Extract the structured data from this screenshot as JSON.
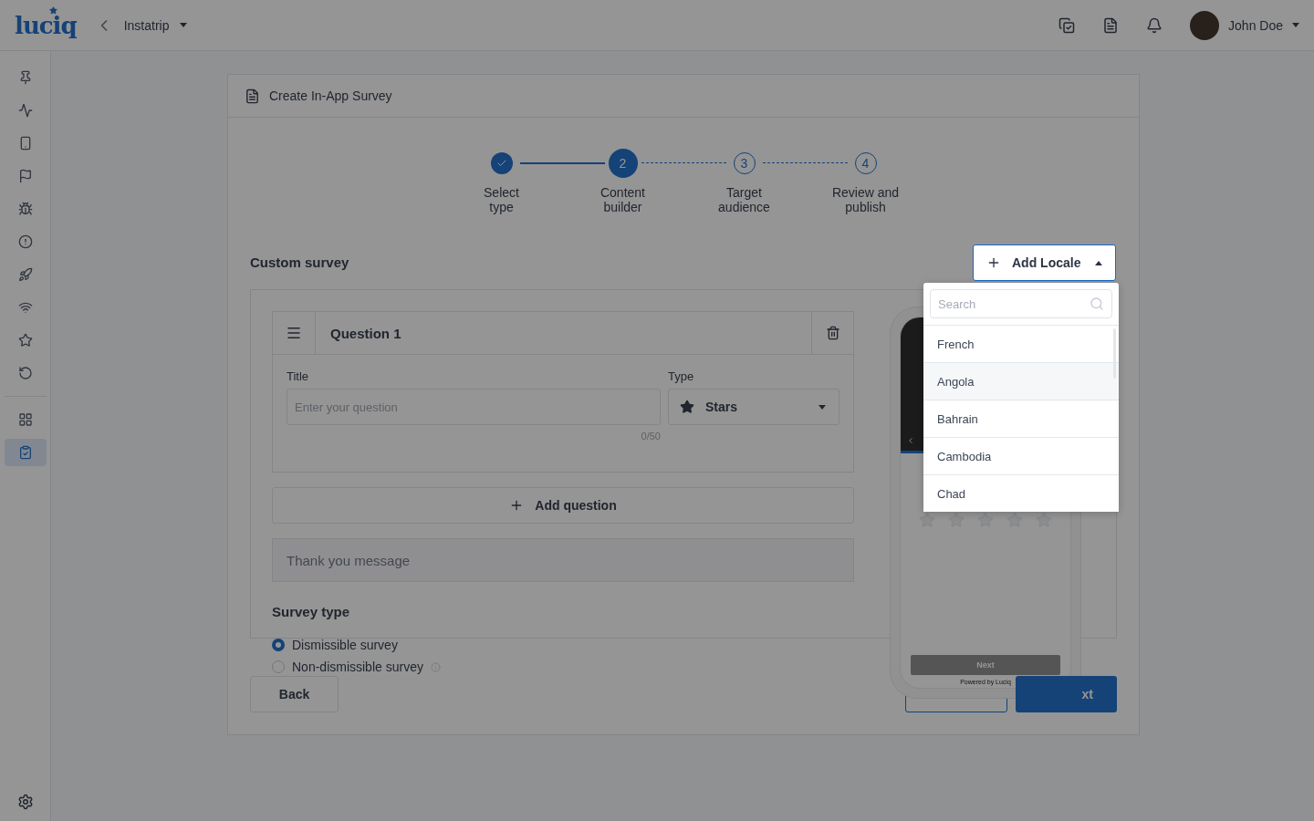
{
  "top_bar": {
    "logo": "luciq",
    "app_name": "Instatrip",
    "user_name": "John Doe"
  },
  "sidebar": {
    "items": [
      {
        "kind": "pin",
        "selected": false
      },
      {
        "kind": "pulse",
        "selected": false
      },
      {
        "kind": "phone",
        "selected": false
      },
      {
        "kind": "flag",
        "selected": false
      },
      {
        "kind": "bug",
        "selected": false
      },
      {
        "kind": "alert",
        "selected": false
      },
      {
        "kind": "rocket",
        "selected": false
      },
      {
        "kind": "wifi",
        "selected": false
      },
      {
        "kind": "star",
        "selected": false
      },
      {
        "kind": "replay",
        "selected": false
      },
      {
        "kind": "apps",
        "selected": false
      },
      {
        "kind": "survey",
        "selected": true
      }
    ]
  },
  "card": {
    "title": "Create In-App Survey"
  },
  "stepper": [
    {
      "label": "Select\ntype",
      "completed": true,
      "selected": false
    },
    {
      "number": "2",
      "label": "Content\nbuilder",
      "completed": false,
      "selected": true
    },
    {
      "number": "3",
      "label": "Target\naudience",
      "completed": false,
      "selected": false
    },
    {
      "number": "4",
      "label": "Review and\npublish",
      "completed": false,
      "selected": false
    }
  ],
  "section_title": "Custom survey",
  "add_locale": {
    "label": "Add Locale",
    "expanded": true
  },
  "locale_dropdown": {
    "search_placeholder": "Search",
    "options": [
      {
        "label": "French",
        "highlighted": false
      },
      {
        "label": "Angola",
        "highlighted": true
      },
      {
        "label": "Bahrain",
        "highlighted": false
      },
      {
        "label": "Cambodia",
        "highlighted": false
      },
      {
        "label": "Chad",
        "highlighted": false
      }
    ]
  },
  "question": {
    "heading": "Question 1",
    "title_label": "Title",
    "title_placeholder": "Enter your question",
    "counter": "0/50",
    "type_label": "Type",
    "type_value": "Stars"
  },
  "add_question": "Add question",
  "thank_you_placeholder": "Thank you message",
  "survey_type": {
    "heading": "Survey type",
    "options": [
      {
        "label": "Dismissible survey",
        "selected": true,
        "info": false
      },
      {
        "label": "Non-dismissible survey",
        "selected": false,
        "info": true
      }
    ]
  },
  "preview": {
    "button": "Next",
    "footer": "Powered by Luciq"
  },
  "footer_buttons": {
    "back": "Back",
    "next": "xt"
  }
}
